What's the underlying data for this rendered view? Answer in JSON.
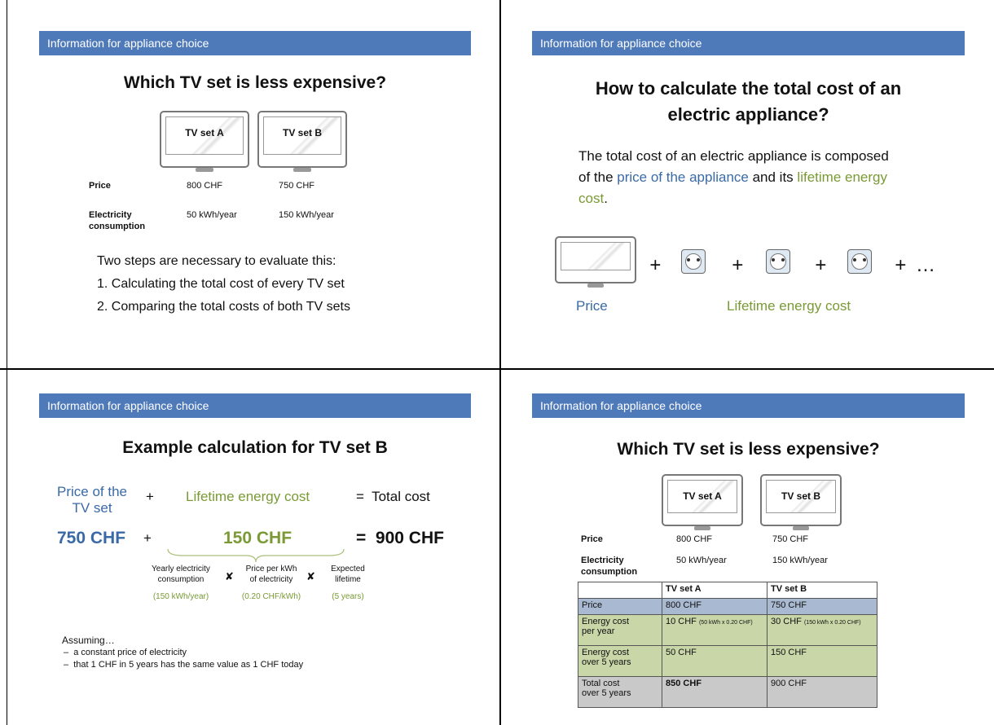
{
  "header": "Information for appliance choice",
  "slide1": {
    "title": "Which TV set is less expensive?",
    "tv_a": "TV set A",
    "tv_b": "TV set B",
    "price_label": "Price",
    "price_a": "800 CHF",
    "price_b": "750 CHF",
    "elec_label_1": "Electricity",
    "elec_label_2": "consumption",
    "elec_a": "50 kWh/year",
    "elec_b": "150 kWh/year",
    "intro": "Two steps are necessary to evaluate this:",
    "step1": "1.  Calculating the total cost of every TV set",
    "step2": "2.  Comparing the total costs of both TV sets"
  },
  "slide2": {
    "title_1": "How to calculate the total cost of an",
    "title_2": "electric appliance?",
    "body_1": "The total cost of an electric appliance is composed",
    "body_2a": "of the ",
    "body_2b": "price of the appliance",
    "body_2c": " and its ",
    "body_2d": "lifetime energy",
    "body_3a": "cost",
    "body_3b": ".",
    "plus": "+",
    "ellipsis": "…",
    "price_caption": "Price",
    "energy_caption": "Lifetime energy cost"
  },
  "slide3": {
    "title": "Example calculation for TV set B",
    "price_label_1": "Price of the",
    "price_label_2": "TV set",
    "plus": "+",
    "energy_label": "Lifetime energy cost",
    "total_label": "=  Total cost",
    "price_value": "750 CHF",
    "energy_value": "150 CHF",
    "total_value": "=  900 CHF",
    "f1_1": "Yearly electricity",
    "f1_2": "consumption",
    "f1_3": "(150 kWh/year)",
    "times": "✘",
    "f2_1": "Price per kWh",
    "f2_2": "of electricity",
    "f2_3": "(0.20 CHF/kWh)",
    "f3_1": "Expected",
    "f3_2": "lifetime",
    "f3_3": "(5 years)",
    "assuming": "Assuming…",
    "a1": "a constant price of electricity",
    "a2": "that 1 CHF in 5 years has the same value as 1 CHF today",
    "dash": "–"
  },
  "slide4": {
    "title": "Which TV set is less expensive?",
    "tv_a": "TV set A",
    "tv_b": "TV set B",
    "price_label": "Price",
    "price_a": "800 CHF",
    "price_b": "750 CHF",
    "elec_label_1": "Electricity",
    "elec_label_2": "consumption",
    "elec_a": "50 kWh/year",
    "elec_b": "150 kWh/year",
    "table": {
      "head": [
        "",
        "TV set A",
        "TV set B"
      ],
      "r1": [
        "Price",
        "800 CHF",
        "750 CHF"
      ],
      "r2_label_1": "Energy cost",
      "r2_label_2": "per year",
      "r2_a_main": "10 CHF",
      "r2_a_small": "(50 kWh x 0.20 CHF)",
      "r2_b_main": "30 CHF",
      "r2_b_small": "(150 kWh x 0.20 CHF)",
      "r3_label_1": "Energy cost",
      "r3_label_2": "over 5 years",
      "r3_a": "50 CHF",
      "r3_b": "150 CHF",
      "r4_label_1": "Total cost",
      "r4_label_2": "over 5 years",
      "r4_a": "850 CHF",
      "r4_b": "900 CHF"
    },
    "colors": {
      "price_row": "#A9B9D1",
      "energy_row": "#C8D6A8",
      "total_row": "#C9C9C9"
    }
  }
}
